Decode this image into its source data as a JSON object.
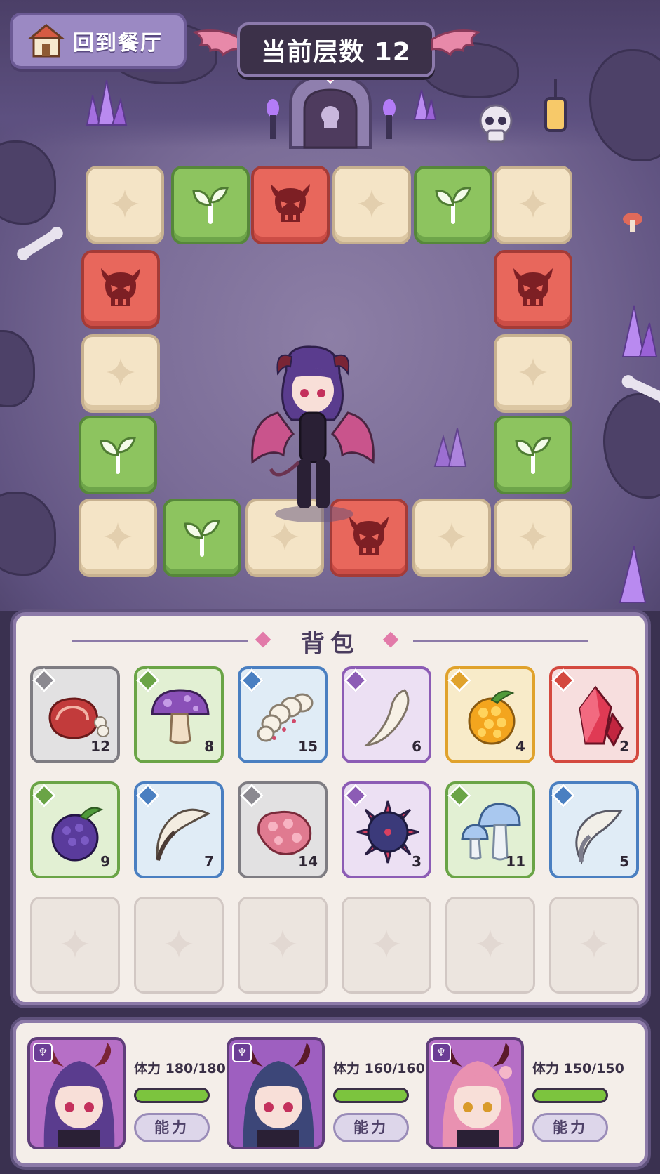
{
  "header": {
    "home_button_label": "回到餐厅",
    "home_icon": "house-icon",
    "floor_label": "当前层数 12"
  },
  "board": {
    "tile_types": {
      "empty": "sparkle-icon",
      "plant": "sprout-icon",
      "monster": "demon-skull-icon"
    },
    "tiles": [
      {
        "id": "t1",
        "type": "empty"
      },
      {
        "id": "t2",
        "type": "plant"
      },
      {
        "id": "t3",
        "type": "monster"
      },
      {
        "id": "t4",
        "type": "empty"
      },
      {
        "id": "t5",
        "type": "plant"
      },
      {
        "id": "t6",
        "type": "empty"
      },
      {
        "id": "t7",
        "type": "monster"
      },
      {
        "id": "t8",
        "type": "monster"
      },
      {
        "id": "t9",
        "type": "empty"
      },
      {
        "id": "t10",
        "type": "empty"
      },
      {
        "id": "t11",
        "type": "plant"
      },
      {
        "id": "t12",
        "type": "plant"
      },
      {
        "id": "t13",
        "type": "empty"
      },
      {
        "id": "t14",
        "type": "plant"
      },
      {
        "id": "t15",
        "type": "empty"
      },
      {
        "id": "t16",
        "type": "monster"
      },
      {
        "id": "t17",
        "type": "empty"
      },
      {
        "id": "t18",
        "type": "empty"
      }
    ]
  },
  "backpack": {
    "title": "背包",
    "items": [
      {
        "icon": "meat-icon",
        "rarity": "gray",
        "count": "12"
      },
      {
        "icon": "purple-mushroom-icon",
        "rarity": "green",
        "count": "8"
      },
      {
        "icon": "larva-icon",
        "rarity": "blue",
        "count": "15"
      },
      {
        "icon": "fang-icon",
        "rarity": "purple",
        "count": "6"
      },
      {
        "icon": "golden-berry-icon",
        "rarity": "gold",
        "count": "4"
      },
      {
        "icon": "red-crystal-icon",
        "rarity": "red",
        "count": "2"
      },
      {
        "icon": "dark-berry-icon",
        "rarity": "green",
        "count": "9"
      },
      {
        "icon": "claw-icon",
        "rarity": "blue",
        "count": "7"
      },
      {
        "icon": "raw-flesh-icon",
        "rarity": "gray",
        "count": "14"
      },
      {
        "icon": "spiked-orb-icon",
        "rarity": "purple",
        "count": "3"
      },
      {
        "icon": "blue-mushroom-icon",
        "rarity": "green",
        "count": "11"
      },
      {
        "icon": "horn-icon",
        "rarity": "blue",
        "count": "5"
      }
    ],
    "empty_slots": 6
  },
  "party": [
    {
      "name_icon": "succubus-purple-portrait",
      "hp_label": "体力  180/180",
      "hp_fraction": 1.0,
      "ability_label": "能力"
    },
    {
      "name_icon": "succubus-navy-portrait",
      "hp_label": "体力 160/160",
      "hp_fraction": 1.0,
      "ability_label": "能力"
    },
    {
      "name_icon": "succubus-pink-portrait",
      "hp_label": "体力  150/150",
      "hp_fraction": 1.0,
      "ability_label": "能力"
    }
  ],
  "colors": {
    "tile_empty": "#f4e4c6",
    "tile_plant": "#8dc45f",
    "tile_monster": "#e8675c",
    "rarity_gray": "#7e7c82",
    "rarity_green": "#6aa446",
    "rarity_blue": "#4a7fc1",
    "rarity_purple": "#8c5cb5",
    "rarity_gold": "#e0a22c",
    "rarity_red": "#d4493f",
    "hp_green": "#7cc43e"
  }
}
